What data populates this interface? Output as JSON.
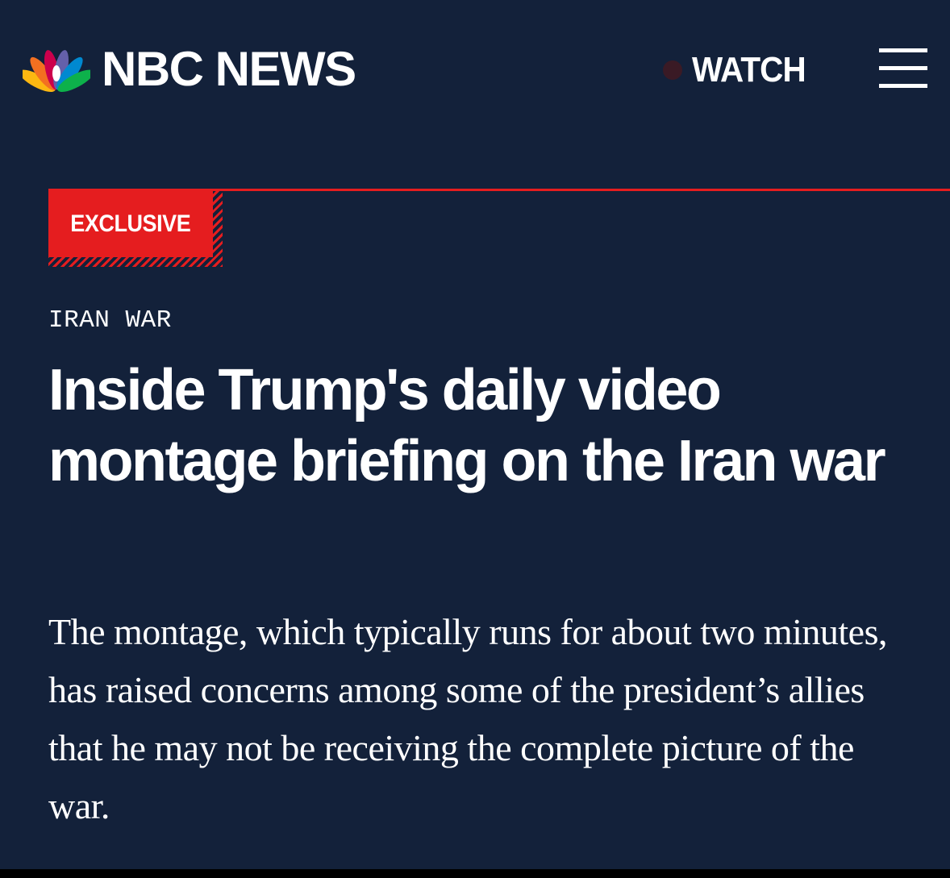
{
  "header": {
    "brand": "NBC NEWS",
    "logo_icon": "nbc-peacock-icon",
    "watch_label": "WATCH",
    "live_dot_icon": "live-dot-icon",
    "menu_icon": "hamburger-menu-icon"
  },
  "article": {
    "badge": "EXCLUSIVE",
    "category": "IRAN WAR",
    "headline": "Inside Trump's daily video montage briefing on the Iran war",
    "dek": "The montage, which typically runs for about two minutes, has raised concerns among some of the president’s allies that he may not be receiving the complete picture of the war."
  },
  "colors": {
    "background": "#13213a",
    "accent_red": "#e51d1f",
    "text": "#ffffff"
  }
}
